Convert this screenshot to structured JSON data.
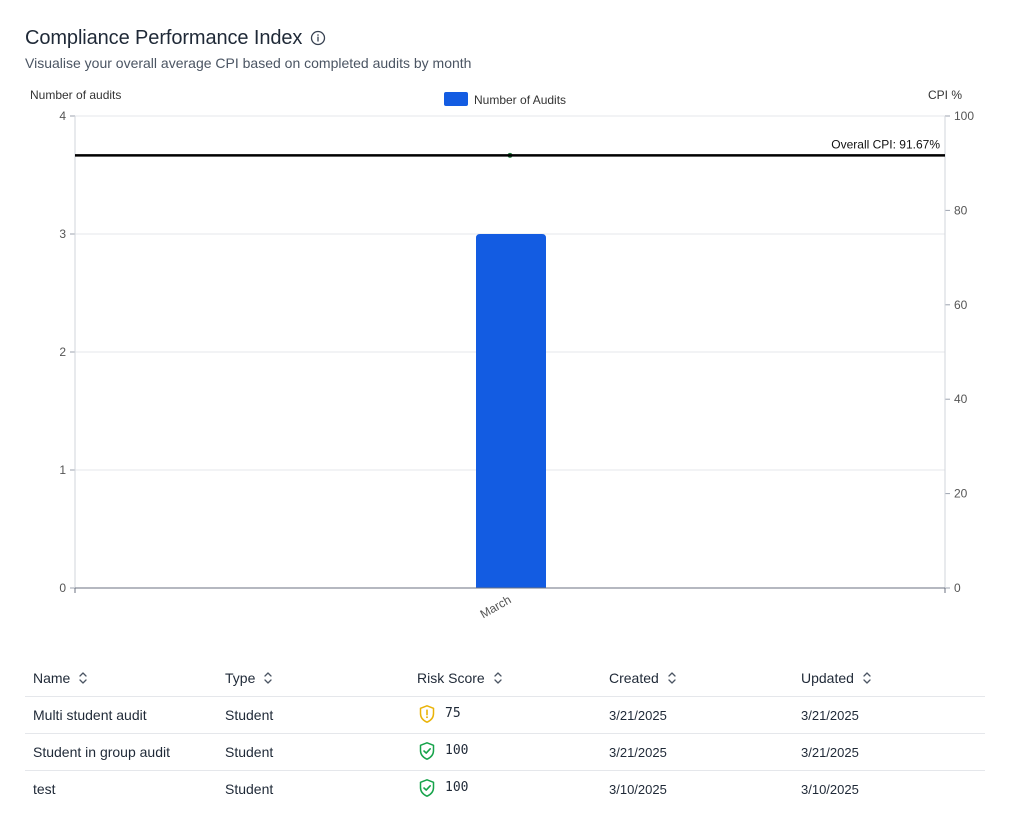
{
  "header": {
    "title": "Compliance Performance Index",
    "subtitle": "Visualise your overall average CPI based on completed audits by month"
  },
  "chart_data": {
    "type": "bar",
    "categories": [
      "March"
    ],
    "series": [
      {
        "name": "Number of Audits",
        "values": [
          3
        ],
        "color": "#135ce2",
        "axis": "left"
      }
    ],
    "ylabel": "Number of audits",
    "ylim": [
      0,
      4
    ],
    "y_ticks": [
      "0",
      "1",
      "2",
      "3",
      "4"
    ],
    "y2label": "CPI %",
    "y2lim": [
      0,
      100
    ],
    "y2_ticks": [
      "0",
      "20",
      "40",
      "60",
      "80",
      "100"
    ],
    "reference_line": {
      "label": "Overall CPI: 91.67%",
      "value": 91.67,
      "axis": "right",
      "color": "#000000"
    },
    "cpi_points": [
      91.67
    ],
    "legend_position": "top-center",
    "grid": true
  },
  "table": {
    "columns": [
      "Name",
      "Type",
      "Risk Score",
      "Created",
      "Updated"
    ],
    "rows": [
      {
        "name": "Multi student audit",
        "type": "Student",
        "risk_score": "75",
        "risk_level": "warning-icon",
        "created": "3/21/2025",
        "updated": "3/21/2025"
      },
      {
        "name": "Student in group audit",
        "type": "Student",
        "risk_score": "100",
        "risk_level": "check-icon",
        "created": "3/21/2025",
        "updated": "3/21/2025"
      },
      {
        "name": "test",
        "type": "Student",
        "risk_score": "100",
        "risk_level": "check-icon",
        "created": "3/10/2025",
        "updated": "3/10/2025"
      }
    ]
  },
  "colors": {
    "bar": "#135ce2",
    "warning": "#eab308",
    "success": "#16a34a"
  }
}
